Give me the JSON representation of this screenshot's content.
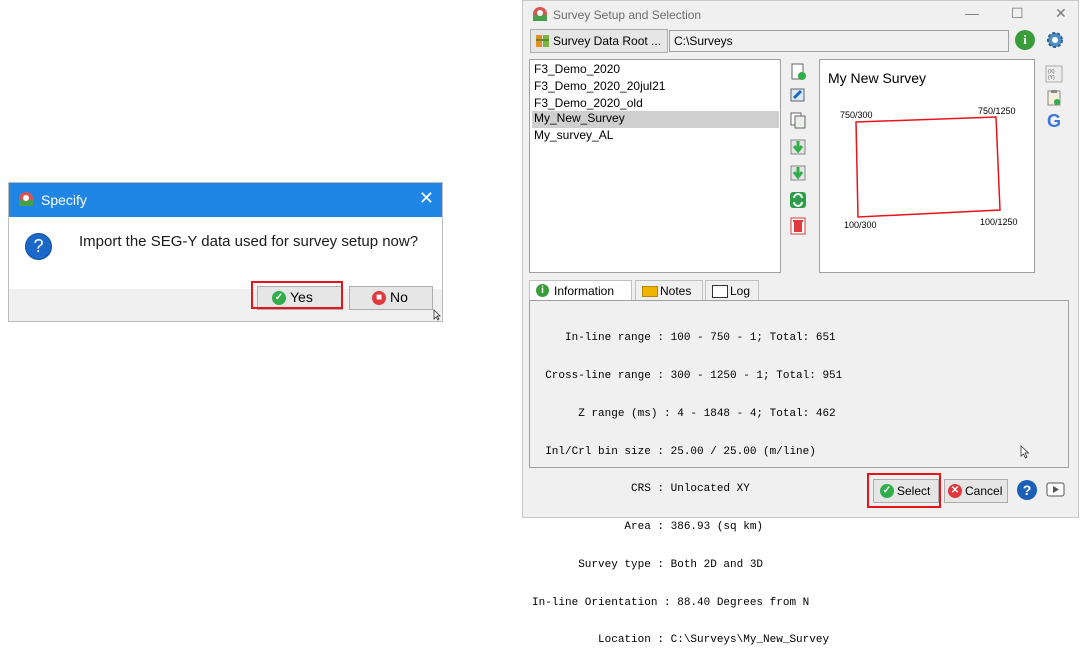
{
  "specify": {
    "title": "Specify",
    "message": "Import the SEG-Y data used for survey setup now?",
    "yes_label": "Yes",
    "no_label": "No",
    "close_glyph": "✕",
    "question_glyph": "?"
  },
  "survey_window": {
    "title": "Survey Setup and Selection",
    "controls": {
      "minimize": "—",
      "maximize": "☐",
      "close": "✕"
    },
    "root_button_label": "Survey Data Root ...",
    "root_path": "C:\\Surveys",
    "surveys": [
      "F3_Demo_2020",
      "F3_Demo_2020_20jul21",
      "F3_Demo_2020_old",
      "My_New_Survey",
      "My_survey_AL"
    ],
    "selected_survey_index": 3,
    "preview": {
      "title": "My New Survey",
      "corner_top_left": "750/300",
      "corner_top_right": "750/1250",
      "corner_bottom_left": "100/300",
      "corner_bottom_right": "100/1250"
    },
    "tabs": [
      "Information",
      "Notes",
      "Log"
    ],
    "info_lines": [
      "     In-line range : 100 - 750 - 1; Total: 651",
      "  Cross-line range : 300 - 1250 - 1; Total: 951",
      "       Z range (ms) : 4 - 1848 - 4; Total: 462",
      "  Inl/Crl bin size : 25.00 / 25.00 (m/line)",
      "               CRS : Unlocated XY",
      "              Area : 386.93 (sq km)",
      "       Survey type : Both 2D and 3D",
      "In-line Orientation : 88.40 Degrees from N",
      "          Location : C:\\Surveys\\My_New_Survey"
    ],
    "select_label": "Select",
    "cancel_label": "Cancel",
    "side_g_label": "G",
    "colors": {
      "highlight": "#e8141c",
      "titlebar_blue": "#1f86e6",
      "select_green": "#2fae4a",
      "cancel_red": "#e0393e"
    }
  }
}
